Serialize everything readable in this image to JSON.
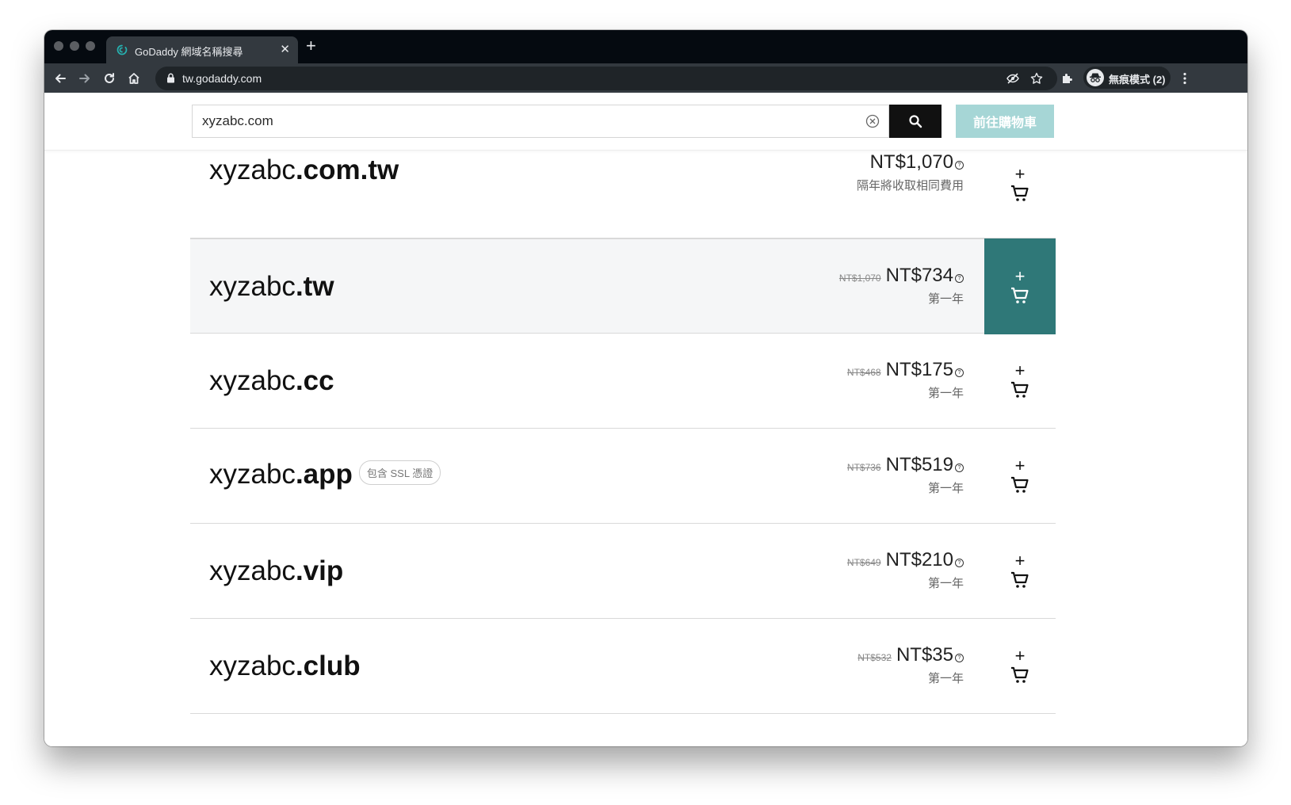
{
  "browser": {
    "tab_title": "GoDaddy 網域名稱搜尋",
    "url": "tw.godaddy.com",
    "profile_label": "無痕模式 (2)"
  },
  "search": {
    "query": "xyzabc.com",
    "cart_button_label": "前往購物車"
  },
  "colors": {
    "accent": "#2f7878",
    "cart_button": "#a6d6d6"
  },
  "results": [
    {
      "name": "xyzabc",
      "tld": ".com.tw",
      "old_price": "",
      "price": "NT$1,070",
      "note": "隔年將收取相同費用",
      "badge": ""
    },
    {
      "name": "xyzabc",
      "tld": ".tw",
      "old_price": "NT$1,070",
      "price": "NT$734",
      "note": "第一年",
      "badge": ""
    },
    {
      "name": "xyzabc",
      "tld": ".cc",
      "old_price": "NT$468",
      "price": "NT$175",
      "note": "第一年",
      "badge": ""
    },
    {
      "name": "xyzabc",
      "tld": ".app",
      "old_price": "NT$736",
      "price": "NT$519",
      "note": "第一年",
      "badge": "包含 SSL 憑證"
    },
    {
      "name": "xyzabc",
      "tld": ".vip",
      "old_price": "NT$649",
      "price": "NT$210",
      "note": "第一年",
      "badge": ""
    },
    {
      "name": "xyzabc",
      "tld": ".club",
      "old_price": "NT$532",
      "price": "NT$35",
      "note": "第一年",
      "badge": ""
    }
  ]
}
